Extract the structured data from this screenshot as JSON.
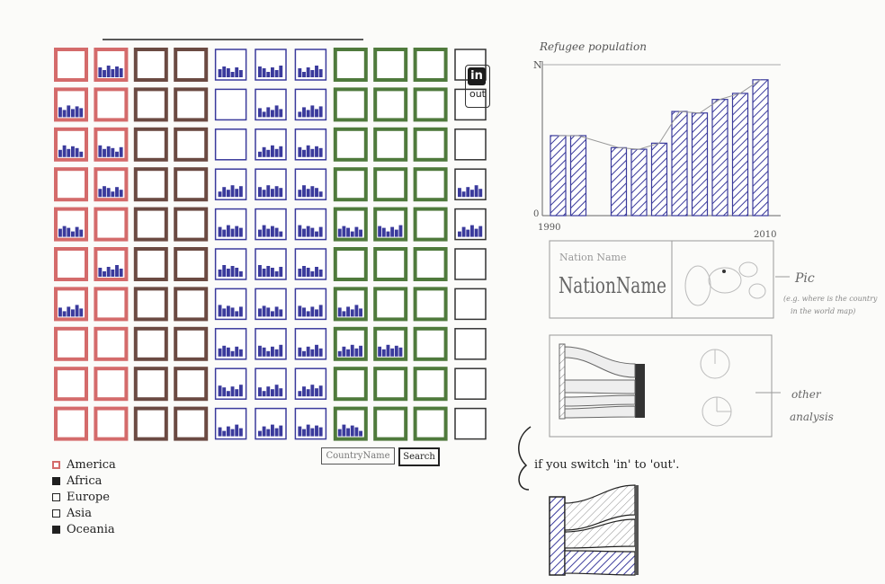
{
  "toggle": {
    "in_label": "in",
    "out_label": "out"
  },
  "search": {
    "placeholder": "CountryName",
    "button_label": "Search"
  },
  "legend": {
    "items": [
      {
        "label": "America",
        "color": "#d46b6b"
      },
      {
        "label": "Africa",
        "color": "#1f1f1f"
      },
      {
        "label": "Europe",
        "color": "#ffffff"
      },
      {
        "label": "Asia",
        "color": "#ffffff"
      },
      {
        "label": "Oceania",
        "color": "#1f1f1f"
      }
    ]
  },
  "grid": {
    "columns": [
      {
        "region": "America",
        "color": "#d46b6b"
      },
      {
        "region": "America",
        "color": "#d46b6b"
      },
      {
        "region": "Africa",
        "color": "#6b4a42"
      },
      {
        "region": "Africa",
        "color": "#6b4a42"
      },
      {
        "region": "Asia",
        "color": "#3a3a9c"
      },
      {
        "region": "Asia",
        "color": "#3a3a9c"
      },
      {
        "region": "Asia",
        "color": "#3a3a9c"
      },
      {
        "region": "Europe",
        "color": "#4f7a3c"
      },
      {
        "region": "Europe",
        "color": "#4f7a3c"
      },
      {
        "region": "Europe",
        "color": "#4f7a3c"
      },
      {
        "region": "Oceania",
        "color": "#333333"
      }
    ],
    "cells_with_bars": [
      "1-0",
      "2-0",
      "4-0",
      "6-0",
      "0-1",
      "2-1",
      "3-1",
      "5-1",
      "0-4",
      "3-4",
      "4-4",
      "5-4",
      "6-4",
      "7-4",
      "8-4",
      "9-4",
      "0-5",
      "1-5",
      "2-5",
      "3-5",
      "4-5",
      "5-5",
      "6-5",
      "7-5",
      "8-5",
      "9-5",
      "0-6",
      "1-6",
      "2-6",
      "3-6",
      "4-6",
      "5-6",
      "6-6",
      "7-6",
      "8-6",
      "9-6",
      "4-7",
      "6-7",
      "7-7",
      "9-7",
      "4-8",
      "7-8",
      "3-10",
      "4-10"
    ]
  },
  "refugee_chart": {
    "title": "Refugee population",
    "y_max_label": "N",
    "y_min_label": "0",
    "x_start_label": "1990",
    "x_end_label": "2010"
  },
  "nation_panel": {
    "label": "Nation Name",
    "name": "NationName",
    "pic_label": "Pic",
    "pic_note_line1": "(e.g. where is the country",
    "pic_note_line2": "in the world map)"
  },
  "analysis_panel": {
    "label_line1": "other",
    "label_line2": "analysis"
  },
  "switch_note": "if you switch 'in' to 'out'.",
  "chart_data": {
    "type": "bar",
    "title": "Refugee population",
    "x": [
      "1990",
      "",
      "",
      "",
      "",
      "",
      "",
      "",
      "",
      "",
      "2010"
    ],
    "values": [
      5.3,
      5.3,
      0,
      4.5,
      4.4,
      4.8,
      6.9,
      6.8,
      7.7,
      8.1,
      9.0
    ],
    "ylim": [
      0,
      10
    ]
  }
}
